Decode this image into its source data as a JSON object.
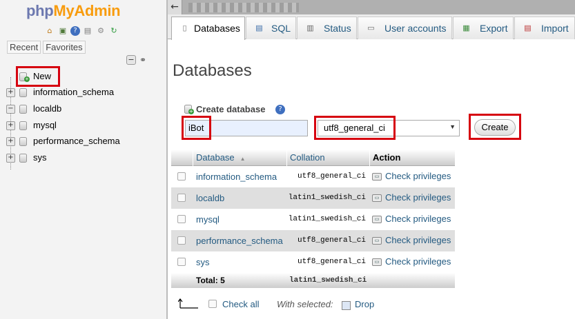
{
  "app": {
    "logo_php": "php",
    "logo_myadmin": "MyAdmin"
  },
  "nav": {
    "quick_icons": [
      "home-icon",
      "exit-icon",
      "help-icon",
      "docs-icon",
      "settings-icon",
      "reload-icon"
    ],
    "recent_label": "Recent",
    "favorites_label": "Favorites",
    "tree": [
      {
        "label": "New"
      },
      {
        "label": "information_schema",
        "expander": "+"
      },
      {
        "label": "localdb",
        "expander": "−"
      },
      {
        "label": "mysql",
        "expander": "+"
      },
      {
        "label": "performance_schema",
        "expander": "+"
      },
      {
        "label": "sys",
        "expander": "+"
      }
    ]
  },
  "tabs": [
    {
      "label": "Databases",
      "icon": "database-icon",
      "active": true
    },
    {
      "label": "SQL",
      "icon": "sql-icon"
    },
    {
      "label": "Status",
      "icon": "status-icon"
    },
    {
      "label": "User accounts",
      "icon": "users-icon"
    },
    {
      "label": "Export",
      "icon": "export-icon"
    },
    {
      "label": "Import",
      "icon": "import-icon"
    }
  ],
  "main": {
    "title": "Databases",
    "create_db": {
      "label": "Create database",
      "name_value": "iBot",
      "collation_value": "utf8_general_ci",
      "create_button": "Create"
    },
    "table": {
      "headers": {
        "database": "Database",
        "collation": "Collation",
        "action": "Action"
      },
      "rows": [
        {
          "name": "information_schema",
          "collation": "utf8_general_ci",
          "action": "Check privileges"
        },
        {
          "name": "localdb",
          "collation": "latin1_swedish_ci",
          "action": "Check privileges"
        },
        {
          "name": "mysql",
          "collation": "latin1_swedish_ci",
          "action": "Check privileges"
        },
        {
          "name": "performance_schema",
          "collation": "utf8_general_ci",
          "action": "Check privileges"
        },
        {
          "name": "sys",
          "collation": "utf8_general_ci",
          "action": "Check privileges"
        }
      ],
      "total_label": "Total: 5",
      "total_collation": "latin1_swedish_ci"
    },
    "footer": {
      "check_all": "Check all",
      "with_selected": "With selected:",
      "drop": "Drop"
    }
  },
  "colors": {
    "highlight": "#d6000f",
    "link": "#235a81",
    "logo_php": "#6c78af",
    "logo_myadmin": "#f89c0e"
  }
}
